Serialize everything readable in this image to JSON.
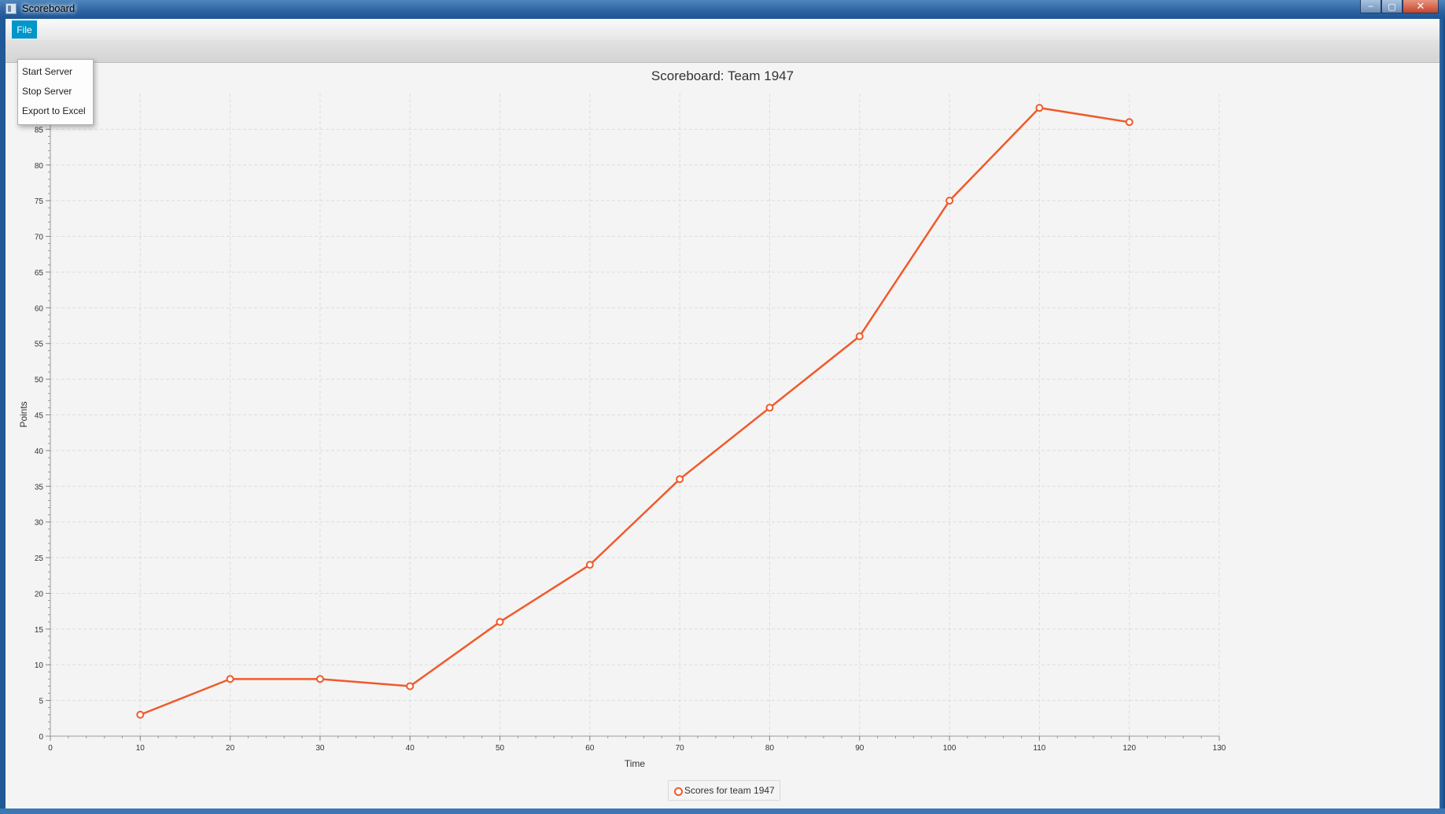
{
  "window": {
    "title": "Scoreboard",
    "controls": {
      "minimize": "–",
      "maximize": "▢",
      "close": "✕"
    }
  },
  "menubar": {
    "file_label": "File"
  },
  "file_menu": {
    "items": [
      "Start Server",
      "Stop Server",
      "Export to Excel"
    ]
  },
  "chart_data": {
    "type": "line",
    "title": "Scoreboard: Team 1947",
    "xlabel": "Time",
    "ylabel": "Points",
    "xlim": [
      0,
      130
    ],
    "ylim": [
      0,
      90
    ],
    "x_ticks": [
      0,
      10,
      20,
      30,
      40,
      50,
      60,
      70,
      80,
      90,
      100,
      110,
      120,
      130
    ],
    "y_ticks": [
      0,
      5,
      10,
      15,
      20,
      25,
      30,
      35,
      40,
      45,
      50,
      55,
      60,
      65,
      70,
      75,
      80,
      85
    ],
    "grid": true,
    "legend_position": "bottom-center",
    "series": [
      {
        "name": "Scores for team 1947",
        "color": "#f05a2a",
        "x": [
          10,
          20,
          30,
          40,
          50,
          60,
          70,
          80,
          90,
          100,
          110,
          120
        ],
        "y": [
          3,
          8,
          8,
          7,
          16,
          24,
          36,
          46,
          56,
          75,
          88,
          86
        ]
      }
    ]
  }
}
